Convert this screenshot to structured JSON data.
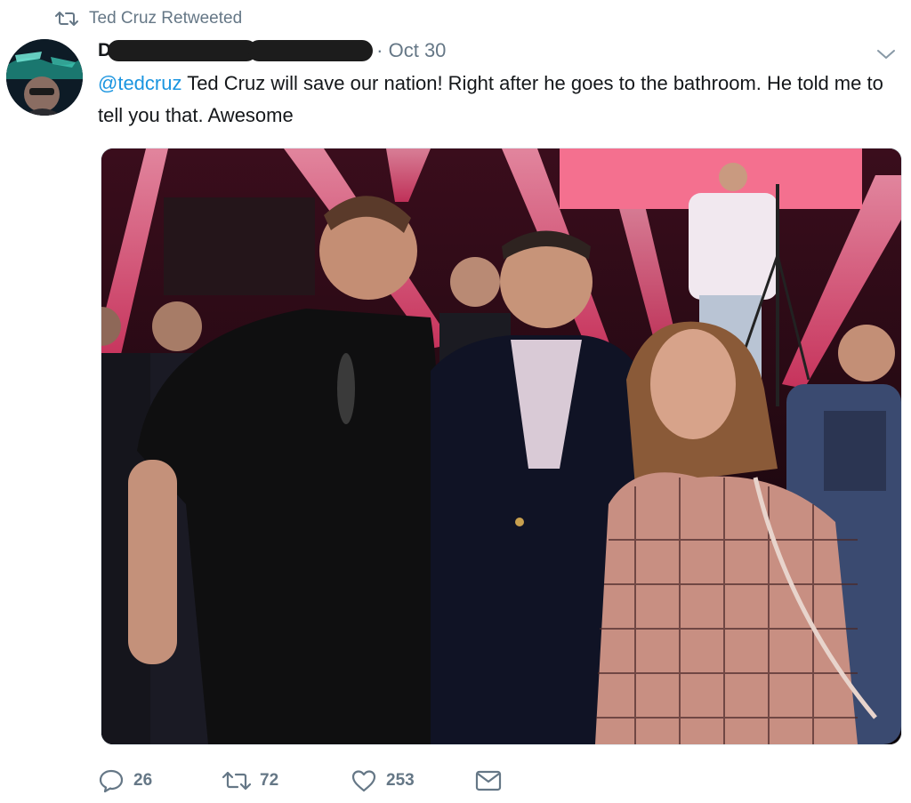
{
  "retweet_banner": {
    "icon": "retweet-icon",
    "text": "Ted Cruz Retweeted"
  },
  "tweet": {
    "author_initial": "D",
    "date": "· Oct 30",
    "mention": "@tedcruz",
    "body": " Ted Cruz will save our nation! Right after he goes to the bathroom. He told me to tell you that. Awesome",
    "media": {
      "description": "photo"
    }
  },
  "actions": {
    "reply": {
      "icon": "reply-icon",
      "count": "26"
    },
    "retweet": {
      "icon": "retweet-icon",
      "count": "72"
    },
    "like": {
      "icon": "heart-icon",
      "count": "253"
    },
    "dm": {
      "icon": "envelope-icon"
    }
  },
  "colors": {
    "muted": "#657786",
    "link": "#1b95e0",
    "text": "#14171a"
  }
}
